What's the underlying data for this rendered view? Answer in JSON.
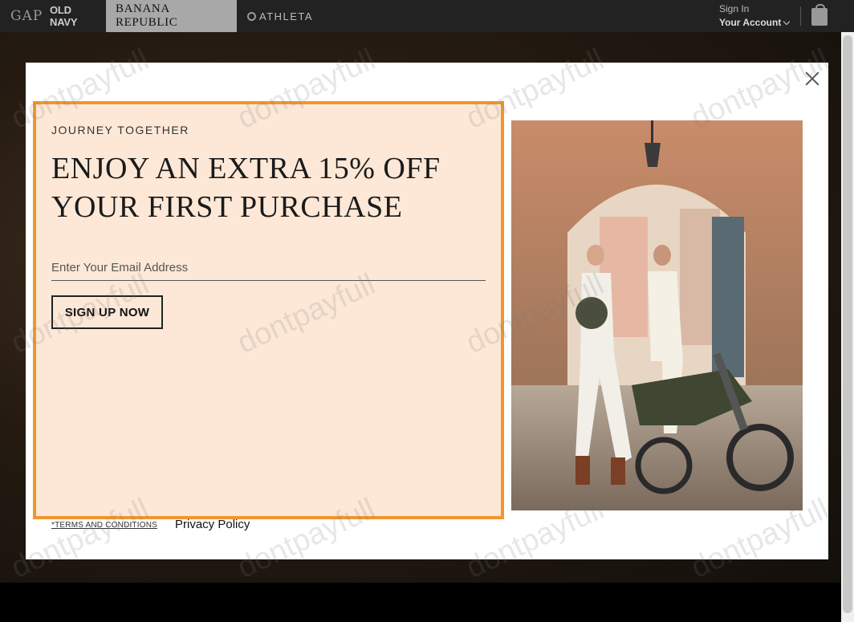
{
  "nav": {
    "brands": [
      "GAP",
      "OLD NAVY",
      "BANANA REPUBLIC",
      "ATHLETA"
    ],
    "sign_in": "Sign In",
    "account": "Your Account"
  },
  "modal": {
    "eyebrow": "JOURNEY TOGETHER",
    "headline_line1": "ENJOY AN EXTRA 15% OFF",
    "headline_line2": "YOUR FIRST PURCHASE",
    "email_placeholder": "Enter Your Email Address",
    "email_value": "",
    "signup_label": "SIGN UP NOW",
    "terms_label": "*TERMS AND CONDITIONS",
    "privacy_label": "Privacy Policy"
  },
  "watermark": "dontpayfull",
  "colors": {
    "panel_bg": "#fde8d7",
    "panel_border": "#f0962f",
    "nav_bg": "#222222"
  }
}
